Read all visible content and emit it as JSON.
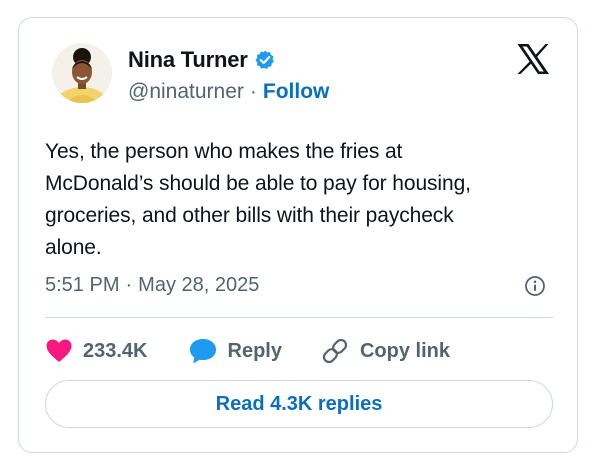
{
  "author": {
    "name": "Nina Turner",
    "handle": "@ninaturner",
    "separator": "·",
    "follow_label": "Follow",
    "verified": true
  },
  "tweet": {
    "text": "Yes, the person who makes the fries at\nMcDonald’s should be able to pay for housing,\ngroceries, and other bills with their paycheck\nalone.",
    "time": "5:51 PM",
    "separator": "·",
    "date": "May 28, 2025"
  },
  "actions": {
    "likes_count": "233.4K",
    "reply_label": "Reply",
    "copy_link_label": "Copy link",
    "read_replies_label": "Read 4.3K replies"
  },
  "icons": {
    "brand": "x-logo-icon",
    "verified": "verified-badge-icon",
    "info": "info-icon",
    "like": "heart-icon",
    "reply": "speech-bubble-icon",
    "copy_link": "link-icon"
  },
  "colors": {
    "text": "#0f1419",
    "secondary": "#536471",
    "link_blue": "#0a6fc2",
    "verified_blue": "#1d9bf0",
    "like_pink": "#f91880",
    "border": "#cfd9de"
  }
}
